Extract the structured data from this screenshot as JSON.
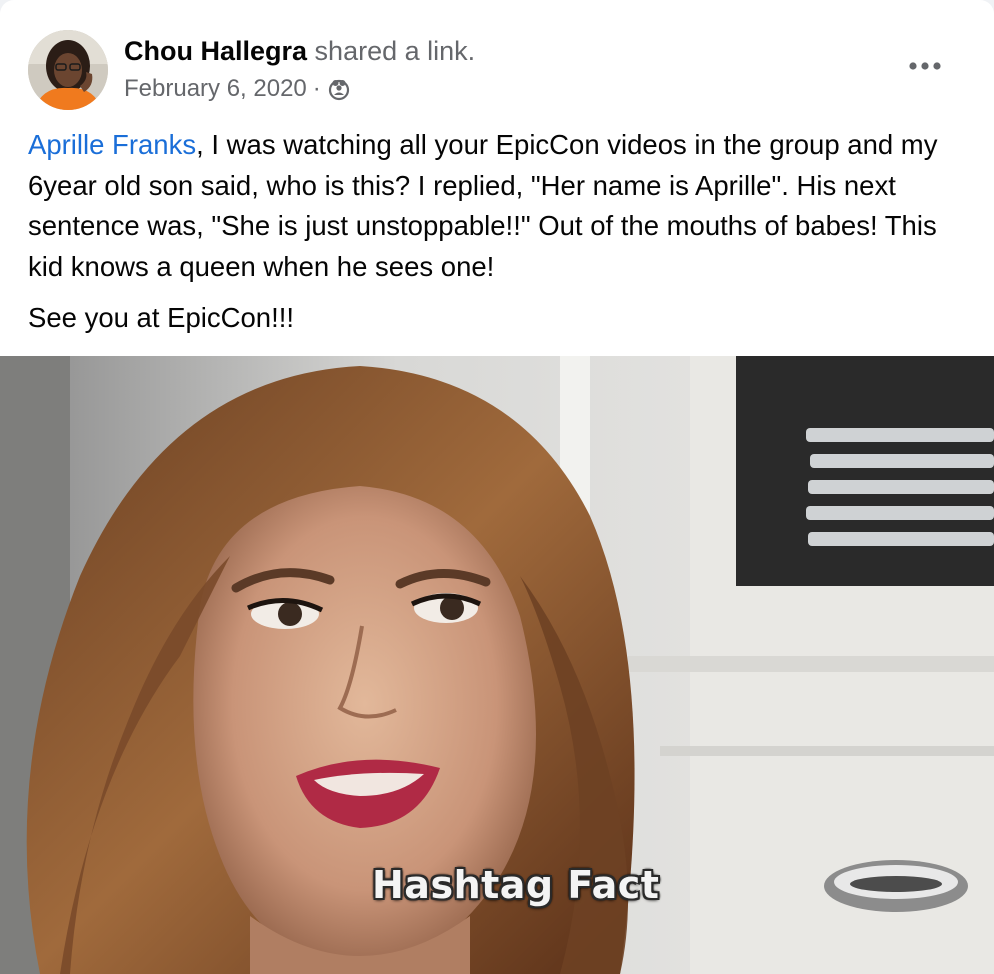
{
  "post": {
    "author": {
      "name": "Chou Hallegra",
      "action": "shared a link."
    },
    "date": "February 6, 2020",
    "separator": "·",
    "audience_icon": "group-audience-icon",
    "more_icon": "more-horizontal-icon",
    "body": {
      "mention": "Aprille Franks",
      "paragraph1_rest": ", I was watching all your EpicCon videos in the group and my 6year old son said, who is this? I replied, \"Her name is Aprille\". His next sentence was, \"She is just unstoppable!!\" Out of the mouths of babes! This kid knows a queen when he sees one!",
      "paragraph2": "See you at EpicCon!!!"
    },
    "media": {
      "type": "gif",
      "caption": "Hashtag Fact"
    }
  },
  "colors": {
    "card_background": "#ffffff",
    "primary_text": "#050505",
    "secondary_text": "#65676b",
    "link": "#1a6ed8"
  }
}
